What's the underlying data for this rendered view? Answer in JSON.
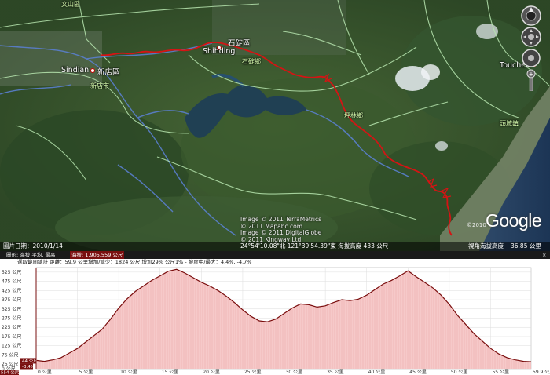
{
  "map": {
    "labels": {
      "wenshan": "文山區",
      "shiding_cn": "石碇區",
      "shiding_en": "Shihding",
      "shiding_town": "石碇鄉",
      "sindian_en": "Sindian",
      "xindian_cn": "新店區",
      "xindian_city": "新店市",
      "pinglin": "坪林鄉",
      "toucheng_cn": "頭城鎮",
      "toucheng_en": "Touchen"
    },
    "credits": {
      "line1": "Image © 2011 TerraMetrics",
      "line2": "© 2011 Mapabc.com",
      "line3": "Image © 2011 DigitalGlobe",
      "line4": "© 2011 Kingway Ltd."
    },
    "google_logo": "Google",
    "google_copyright": "©2010"
  },
  "status_bar": {
    "image_date": "圖片日期：2010/1/14",
    "coordinates": "24°54'10.08\"北  121°39'54.39\"東 海拔高度  433 公尺",
    "eye_alt": "視角海拔高度",
    "eye_alt_value": "36.85 公里"
  },
  "elevation_panel": {
    "header_prefix": "圖形: 海拔  平均, 最高 ",
    "header_highlight": "海拔: 1,905,559 公尺",
    "close": "×",
    "stats": "選取範圍總計  距離：59.9 公里增加/減少：1824 公尺 增加29% 公尺1% -  坡度中/最大：4.4%,  -4.7%",
    "cursor_value": "44 公尺",
    "cursor_grade": "-3.4%",
    "bottom_left": "554 公尺"
  },
  "chart_data": {
    "type": "area",
    "title": "",
    "xlabel": "",
    "ylabel": "",
    "xlim": [
      0,
      59.9
    ],
    "ylim": [
      0,
      550
    ],
    "y_ticks": [
      0,
      25,
      75,
      125,
      175,
      225,
      275,
      325,
      375,
      425,
      475,
      525
    ],
    "y_tick_labels": [
      "0 公尺",
      "25 公尺",
      "75 公尺",
      "125 公尺",
      "175 公尺",
      "225 公尺",
      "275 公尺",
      "325 公尺",
      "375 公尺",
      "425 公尺",
      "475 公尺",
      "525 公尺"
    ],
    "x_ticks": [
      0,
      5,
      10,
      15,
      20,
      25,
      30,
      35,
      40,
      45,
      50,
      55,
      59.9
    ],
    "x_tick_labels": [
      "0 公里",
      "5 公里",
      "10 公里",
      "15 公里",
      "20 公里",
      "25 公里",
      "30 公里",
      "35 公里",
      "40 公里",
      "45 公里",
      "50 公里",
      "55 公里",
      "59.9 公里"
    ],
    "series": [
      {
        "x": [
          0,
          1,
          2,
          3,
          4,
          5,
          6,
          7,
          8,
          9,
          10,
          11,
          12,
          13,
          14,
          15,
          16,
          17,
          18,
          19,
          20,
          21,
          22,
          23,
          24,
          25,
          26,
          27,
          28,
          29,
          30,
          31,
          32,
          33,
          34,
          35,
          36,
          37,
          38,
          39,
          40,
          41,
          42,
          43,
          44,
          45,
          46,
          47,
          48,
          49,
          50,
          51,
          52,
          53,
          54,
          55,
          56,
          57,
          58,
          59,
          59.9
        ],
        "values": [
          45,
          40,
          48,
          60,
          85,
          110,
          145,
          180,
          215,
          270,
          330,
          380,
          420,
          450,
          480,
          505,
          530,
          540,
          520,
          495,
          470,
          450,
          425,
          395,
          360,
          320,
          285,
          260,
          255,
          270,
          300,
          330,
          352,
          348,
          335,
          342,
          360,
          375,
          370,
          378,
          400,
          430,
          460,
          480,
          505,
          532,
          500,
          470,
          440,
          400,
          350,
          290,
          240,
          190,
          150,
          110,
          80,
          60,
          48,
          40,
          38
        ],
        "color": "#7a0d0d",
        "fill": "#f6c9c9"
      }
    ],
    "grid": true
  },
  "colors": {
    "route": "#d41414",
    "road": "#b8e6b0",
    "river": "#5a7fcf",
    "elev_line": "#7a0d0d",
    "elev_fill": "#f6c9c9"
  }
}
